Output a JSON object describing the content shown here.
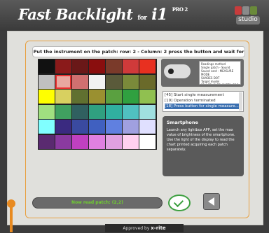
{
  "header": {
    "app_title": "Fast Backlight",
    "for": "for",
    "i1": "i1",
    "pro": "PRO 2",
    "studio_label": "studio"
  },
  "instruction": "Put the instrument on the patch: row: 2 - Column: 2 press the button and wait for 2 beeps!",
  "grid": {
    "rows": [
      [
        "#111111",
        "#8a1a1a",
        "#6a1818",
        "#8a0e0e",
        "#7a3a2a",
        "#d03a3a",
        "#e83020"
      ],
      [
        "#c0c0c0",
        "#e8a8a0",
        "#d07070",
        "#f2f2f2",
        "#5a5a3a",
        "#7a8a3a",
        "#6a6a2a"
      ],
      [
        "#ffff00",
        "#d8d060",
        "#607030",
        "#9a9030",
        "#5aa040",
        "#30a040",
        "#90c050"
      ],
      [
        "#a0e080",
        "#40a060",
        "#306060",
        "#30a080",
        "#30b0a0",
        "#50c0c0",
        "#a0e0e0"
      ],
      [
        "#80ffff",
        "#3a2a80",
        "#3a4aa0",
        "#4060c0",
        "#6080e0",
        "#a0a0e0",
        "#e0e0ff"
      ],
      [
        "#5a2a70",
        "#8a3aa0",
        "#c040c0",
        "#e080e0",
        "#e0a0e0",
        "#ffd0f0",
        "#ffffff"
      ]
    ]
  },
  "device_info": {
    "lines": [
      "Readings method",
      "Single patch - Sound",
      "Sound card - MEASURE MODE",
      "SHADES DOT",
      "Target model",
      "52_LCD_OLED_EARTH_PRO_XXX"
    ]
  },
  "log": {
    "items": [
      "[45] Start single measurement",
      "[19] Operation terminated",
      "[18] Press button for single measure..."
    ]
  },
  "info": {
    "heading": "Smartphone",
    "text": "Launch any lightbox APP, set the max value of brightness of the smartphone. Use the light of the display to read the chart printed acquiring each patch separately."
  },
  "status": {
    "text": "Now read patch: (2,2)"
  },
  "footer": {
    "approved_by": "Approved by",
    "brand": "x-rite"
  }
}
